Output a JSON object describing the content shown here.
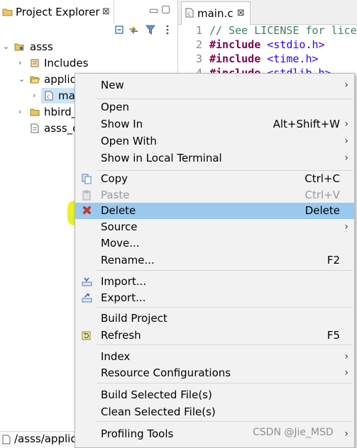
{
  "explorer": {
    "tab_title": "Project Explorer",
    "tab_close": "⊠",
    "minimize_glyph": "▭",
    "maximize_glyph": "▢",
    "tree": [
      {
        "label": "asss",
        "twisty": "expanded",
        "icon": "project-icon"
      },
      {
        "label": "Includes",
        "twisty": "collapsed",
        "icon": "includes-icon"
      },
      {
        "label": "applic",
        "twisty": "expanded",
        "icon": "folder-icon"
      },
      {
        "label": "ma",
        "twisty": "collapsed",
        "icon": "c-file-icon"
      },
      {
        "label": "hbird_",
        "twisty": "collapsed",
        "icon": "folder-icon"
      },
      {
        "label": "asss_c",
        "twisty": "none",
        "icon": "text-file-icon"
      }
    ],
    "bottom_path": "/asss/applic"
  },
  "editor": {
    "tab_title": "main.c",
    "tab_close": "⊠",
    "lines": [
      {
        "num": "1",
        "type": "comment",
        "text": "// See LICENSE for lice"
      },
      {
        "num": "2",
        "type": "include",
        "kw": "#include",
        "header": "<stdio.h>"
      },
      {
        "num": "3",
        "type": "include",
        "kw": "#include",
        "header": "<time.h>"
      },
      {
        "num": "4",
        "type": "include",
        "kw": "#include",
        "header": "<stdlib.h>"
      }
    ]
  },
  "context_menu": {
    "items": [
      {
        "label": "New",
        "accel": "",
        "submenu": true
      },
      {
        "sep": true
      },
      {
        "label": "Open",
        "accel": ""
      },
      {
        "label": "Show In",
        "accel": "Alt+Shift+W",
        "submenu": true
      },
      {
        "label": "Open With",
        "accel": "",
        "submenu": true
      },
      {
        "label": "Show in Local Terminal",
        "accel": "",
        "submenu": true
      },
      {
        "sep": true
      },
      {
        "label": "Copy",
        "accel": "Ctrl+C",
        "icon": "copy-icon"
      },
      {
        "label": "Paste",
        "accel": "Ctrl+V",
        "icon": "paste-icon",
        "disabled": true
      },
      {
        "label": "Delete",
        "accel": "Delete",
        "icon": "delete-icon",
        "selected": true
      },
      {
        "label": "Source",
        "accel": "",
        "submenu": true
      },
      {
        "label": "Move...",
        "accel": ""
      },
      {
        "label": "Rename...",
        "accel": "F2"
      },
      {
        "sep": true
      },
      {
        "label": "Import...",
        "accel": "",
        "icon": "import-icon"
      },
      {
        "label": "Export...",
        "accel": "",
        "icon": "export-icon"
      },
      {
        "sep": true
      },
      {
        "label": "Build Project",
        "accel": ""
      },
      {
        "label": "Refresh",
        "accel": "F5",
        "icon": "refresh-icon"
      },
      {
        "sep": true
      },
      {
        "label": "Index",
        "accel": "",
        "submenu": true
      },
      {
        "label": "Resource Configurations",
        "accel": "",
        "submenu": true
      },
      {
        "sep": true
      },
      {
        "label": "Build Selected File(s)",
        "accel": ""
      },
      {
        "label": "Clean Selected File(s)",
        "accel": ""
      },
      {
        "sep": true
      },
      {
        "label": "Profiling Tools",
        "accel": "",
        "submenu": true
      }
    ],
    "highlight_color": "#e6f21a",
    "selected_color": "#99c9ef"
  },
  "watermark": "CSDN @Jie_MSD"
}
